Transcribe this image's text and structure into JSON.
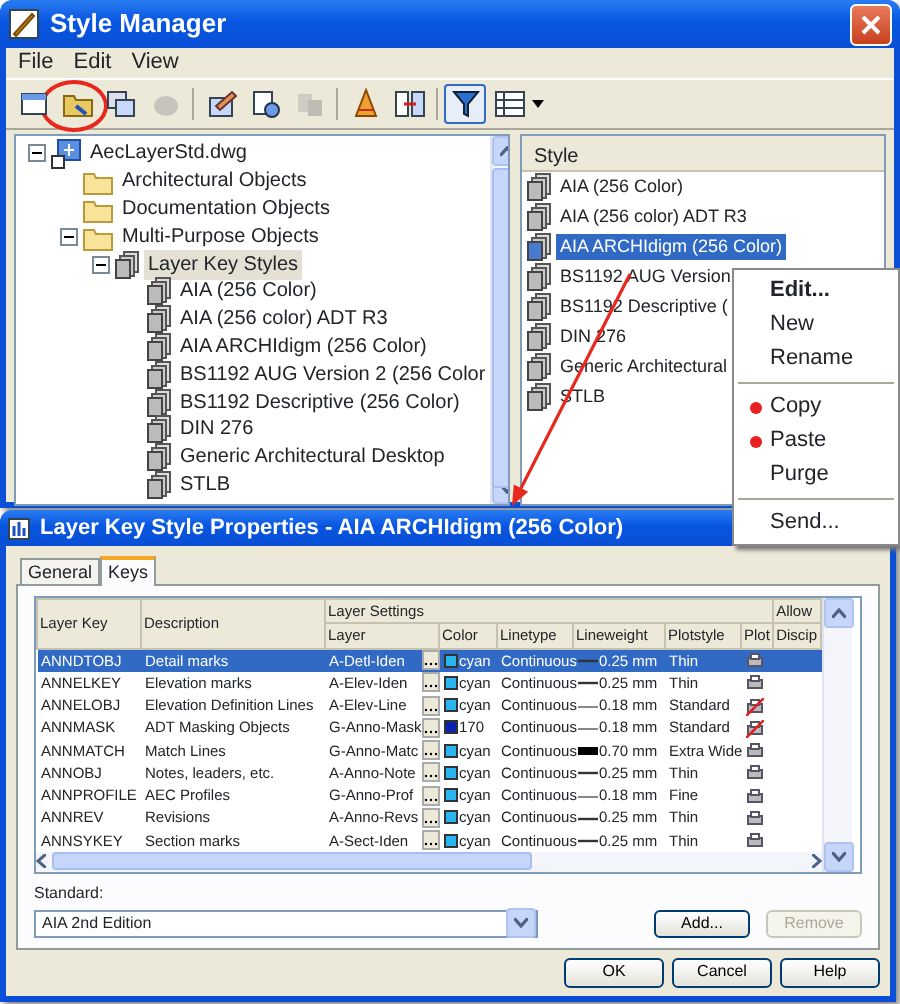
{
  "window": {
    "title": "Style Manager"
  },
  "menu": [
    "File",
    "Edit",
    "View"
  ],
  "toolbar": [
    {
      "circled": false,
      "pressed": false,
      "disabled": false
    },
    {
      "circled": true,
      "pressed": false,
      "disabled": false
    },
    {
      "circled": false,
      "pressed": false,
      "disabled": false
    },
    {
      "circled": false,
      "pressed": false,
      "disabled": true
    },
    {
      "circled": false,
      "pressed": false,
      "disabled": false
    },
    {
      "circled": false,
      "pressed": false,
      "disabled": false
    },
    {
      "circled": false,
      "pressed": false,
      "disabled": true
    },
    {
      "circled": false,
      "pressed": false,
      "disabled": false
    },
    {
      "circled": false,
      "pressed": false,
      "disabled": false
    },
    {
      "circled": false,
      "pressed": true,
      "disabled": false
    },
    {
      "circled": false,
      "pressed": false,
      "disabled": false
    }
  ],
  "tree": [
    {
      "label": "AecLayerStd.dwg",
      "kind": "drawing",
      "expanded": true,
      "selected": false,
      "children": [
        {
          "label": "Architectural Objects",
          "kind": "folder",
          "selected": false
        },
        {
          "label": "Documentation Objects",
          "kind": "folder",
          "selected": false
        },
        {
          "label": "Multi-Purpose Objects",
          "kind": "folder",
          "expanded": true,
          "selected": false,
          "children": [
            {
              "label": "Layer Key Styles",
              "kind": "stack",
              "expanded": true,
              "selected": true,
              "children": [
                {
                  "label": "AIA (256 Color)",
                  "kind": "style",
                  "selected": false
                },
                {
                  "label": "AIA (256 color) ADT R3",
                  "kind": "style",
                  "selected": false
                },
                {
                  "label": "AIA ARCHIdigm (256 Color)",
                  "kind": "style",
                  "selected": false
                },
                {
                  "label": "BS1192 AUG Version 2 (256 Color",
                  "kind": "style",
                  "selected": false
                },
                {
                  "label": "BS1192 Descriptive (256 Color)",
                  "kind": "style",
                  "selected": false
                },
                {
                  "label": "DIN 276",
                  "kind": "style",
                  "selected": false
                },
                {
                  "label": "Generic Architectural Desktop",
                  "kind": "style",
                  "selected": false
                },
                {
                  "label": "STLB",
                  "kind": "style",
                  "selected": false
                }
              ]
            }
          ]
        }
      ]
    }
  ],
  "style_list": {
    "header": "Style",
    "items": [
      {
        "label": "AIA (256 Color)",
        "selected": false
      },
      {
        "label": "AIA (256 color) ADT R3",
        "selected": false
      },
      {
        "label": "AIA ARCHIdigm (256 Color)",
        "selected": true
      },
      {
        "label": "BS1192 AUG Version",
        "selected": false
      },
      {
        "label": "BS1192 Descriptive (",
        "selected": false
      },
      {
        "label": "DIN 276",
        "selected": false
      },
      {
        "label": "Generic Architectural",
        "selected": false
      },
      {
        "label": "STLB",
        "selected": false
      }
    ]
  },
  "context_menu": [
    {
      "kind": "item",
      "label": "Edit...",
      "default": true,
      "bullet": false
    },
    {
      "kind": "item",
      "label": "New",
      "default": false,
      "bullet": false
    },
    {
      "kind": "item",
      "label": "Rename",
      "default": false,
      "bullet": false
    },
    {
      "kind": "separator"
    },
    {
      "kind": "item",
      "label": "Copy",
      "default": false,
      "bullet": true
    },
    {
      "kind": "item",
      "label": "Paste",
      "default": false,
      "bullet": true
    },
    {
      "kind": "item",
      "label": "Purge",
      "default": false,
      "bullet": false
    },
    {
      "kind": "separator"
    },
    {
      "kind": "item",
      "label": "Send...",
      "default": false,
      "bullet": false
    }
  ],
  "dialog": {
    "title": "Layer Key Style Properties - AIA ARCHIdigm (256 Color)",
    "tabs": [
      {
        "label": "General",
        "selected": false
      },
      {
        "label": "Keys",
        "selected": true
      }
    ],
    "table": {
      "column_groups": [
        "Layer Settings",
        "Allow"
      ],
      "columns": [
        "Layer Key",
        "Description",
        "Layer",
        "Color",
        "Linetype",
        "Lineweight",
        "Plotstyle",
        "Plot",
        "Discip"
      ],
      "rows": [
        {
          "kind": "medium",
          "layer_key": "ANNDTOBJ",
          "description": "Detail marks",
          "layer": "A-Detl-Iden",
          "color_name": "cyan",
          "color": "#29b6f0",
          "linetype": "Continuous",
          "lineweight": "0.25 mm",
          "plotstyle": "Thin",
          "plot": true,
          "selected": true
        },
        {
          "kind": "medium",
          "layer_key": "ANNELKEY",
          "description": "Elevation marks",
          "layer": "A-Elev-Iden",
          "color_name": "cyan",
          "color": "#29b6f0",
          "linetype": "Continuous",
          "lineweight": "0.25 mm",
          "plotstyle": "Thin",
          "plot": true,
          "selected": false
        },
        {
          "kind": "thin",
          "layer_key": "ANNELOBJ",
          "description": "Elevation Definition Lines",
          "layer": "A-Elev-Line",
          "color_name": "cyan",
          "color": "#29b6f0",
          "linetype": "Continuous",
          "lineweight": "0.18 mm",
          "plotstyle": "Standard",
          "plot": false,
          "selected": false
        },
        {
          "kind": "thin",
          "layer_key": "ANNMASK",
          "description": "ADT Masking Objects",
          "layer": "G-Anno-Mask",
          "color_name": "170",
          "color": "#0a22b0",
          "linetype": "Continuous",
          "lineweight": "0.18 mm",
          "plotstyle": "Standard",
          "plot": false,
          "selected": false
        },
        {
          "kind": "thick",
          "layer_key": "ANNMATCH",
          "description": "Match Lines",
          "layer": "G-Anno-Matc",
          "color_name": "cyan",
          "color": "#29b6f0",
          "linetype": "Continuous",
          "lineweight": "0.70 mm",
          "plotstyle": "Extra Wide",
          "plot": true,
          "selected": false
        },
        {
          "kind": "medium",
          "layer_key": "ANNOBJ",
          "description": "Notes, leaders, etc.",
          "layer": "A-Anno-Note",
          "color_name": "cyan",
          "color": "#29b6f0",
          "linetype": "Continuous",
          "lineweight": "0.25 mm",
          "plotstyle": "Thin",
          "plot": true,
          "selected": false
        },
        {
          "kind": "thin",
          "layer_key": "ANNPROFILE",
          "description": "AEC Profiles",
          "layer": "G-Anno-Prof",
          "color_name": "cyan",
          "color": "#29b6f0",
          "linetype": "Continuous",
          "lineweight": "0.18 mm",
          "plotstyle": "Fine",
          "plot": true,
          "selected": false
        },
        {
          "kind": "medium",
          "layer_key": "ANNREV",
          "description": "Revisions",
          "layer": "A-Anno-Revs",
          "color_name": "cyan",
          "color": "#29b6f0",
          "linetype": "Continuous",
          "lineweight": "0.25 mm",
          "plotstyle": "Thin",
          "plot": true,
          "selected": false
        },
        {
          "kind": "medium",
          "layer_key": "ANNSYKEY",
          "description": "Section marks",
          "layer": "A-Sect-Iden",
          "color_name": "cyan",
          "color": "#29b6f0",
          "linetype": "Continuous",
          "lineweight": "0.25 mm",
          "plotstyle": "Thin",
          "plot": true,
          "selected": false
        }
      ]
    },
    "standard_label": "Standard:",
    "standard_value": "AIA 2nd Edition",
    "buttons": [
      {
        "label": "Add...",
        "disabled": false
      },
      {
        "label": "Remove",
        "disabled": true
      }
    ],
    "footer_buttons": [
      "OK",
      "Cancel",
      "Help"
    ]
  }
}
